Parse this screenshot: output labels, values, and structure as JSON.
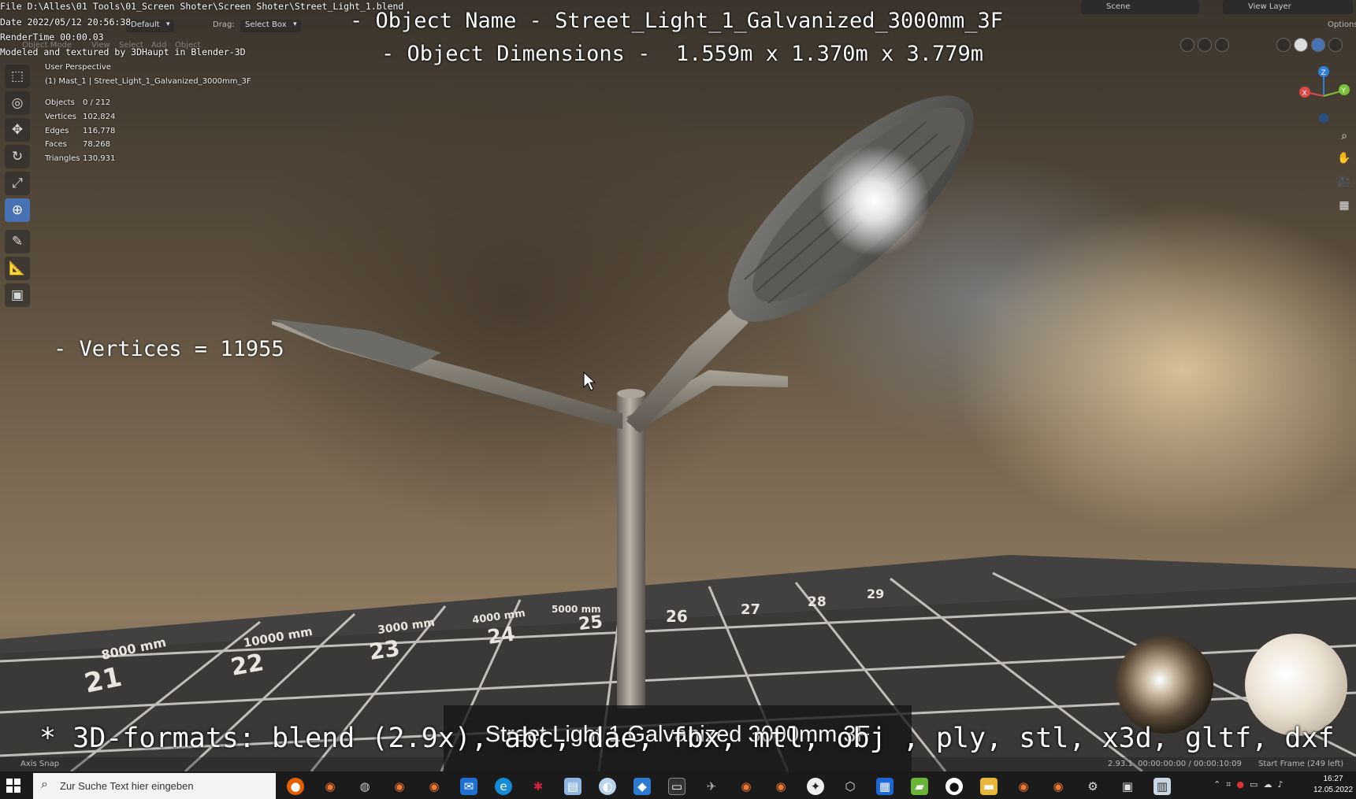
{
  "window": {
    "file_path": "File D:\\Alles\\01 Tools\\01_Screen Shoter\\Screen Shoter\\Street_Light_1.blend",
    "date": "Date 2022/05/12 20:56:38",
    "render_time": "RenderTime 00:00.03",
    "credit": "Modeled and textured by 3DHaupt in Blender-3D"
  },
  "header": {
    "workspace_dropdown": "Default",
    "drag_label": "Drag:",
    "drag_dropdown": "Select Box",
    "menu": [
      "Object Mode",
      "View",
      "Select",
      "Add",
      "Object"
    ],
    "scene_label": "Scene",
    "view_layer_label": "View Layer",
    "options_label": "Options"
  },
  "overlay_text": {
    "object_name": "- Object Name - Street_Light_1_Galvanized_3000mm_3F",
    "object_dimensions": "- Object Dimensions -  1.559m x 1.370m x 3.779m",
    "vertices": "- Vertices = 11955",
    "formats": "* 3D-formats: blend (2.9x), abc, dae, fbx, mtl, obj , ply, stl, x3d, gltf, dxf"
  },
  "viewport_stats": {
    "perspective": "User Perspective",
    "collection": "(1) Mast_1 | Street_Light_1_Galvanized_3000mm_3F",
    "rows": [
      {
        "label": "Objects",
        "value": "0 / 212"
      },
      {
        "label": "Vertices",
        "value": "102,824"
      },
      {
        "label": "Edges",
        "value": "116,778"
      },
      {
        "label": "Faces",
        "value": "78,268"
      },
      {
        "label": "Triangles",
        "value": "130,931"
      }
    ]
  },
  "toolbar": {
    "tools": [
      "select-box-icon",
      "cursor-icon",
      "move-icon",
      "rotate-icon",
      "scale-icon",
      "transform-icon",
      "annotate-icon",
      "measure-icon",
      "add-cube-icon"
    ],
    "active": "transform-icon"
  },
  "gizmo": {
    "axes": [
      {
        "label": "Z",
        "color": "#2f7fd6"
      },
      {
        "label": "Y",
        "color": "#7cc23a"
      },
      {
        "label": "X",
        "color": "#e04848"
      }
    ]
  },
  "grid_labels": [
    "21",
    "22",
    "23",
    "24",
    "25",
    "26",
    "27",
    "28",
    "29"
  ],
  "grid_sub_labels": [
    "8000 mm",
    "10000 mm",
    "3000 mm",
    "4000 mm",
    "5000 mm"
  ],
  "caption": "Street Light 1 Galvanized 3000mm 3F",
  "statusbar": {
    "snap": "Axis Snap",
    "version": "2.93.1  00:00:00:00 / 00:00:10:09",
    "start_frame": "Start Frame (249 left)"
  },
  "taskbar": {
    "search_placeholder": "Zur Suche Text hier eingeben",
    "apps": [
      "firefox-icon",
      "blender-icon",
      "steam-icon",
      "blender-icon",
      "blender-icon",
      "mail-icon",
      "edge-icon",
      "app-icon",
      "notes-icon",
      "app-icon",
      "app-icon",
      "terminal-icon",
      "app-icon",
      "blender-icon",
      "blender-icon",
      "app-icon",
      "box-icon",
      "calendar-icon",
      "app-icon",
      "app-icon",
      "folder-icon",
      "blender-icon",
      "blender-icon",
      "settings-icon",
      "app-icon",
      "app-icon"
    ],
    "time": "16:27",
    "date": "12.05.2022"
  }
}
